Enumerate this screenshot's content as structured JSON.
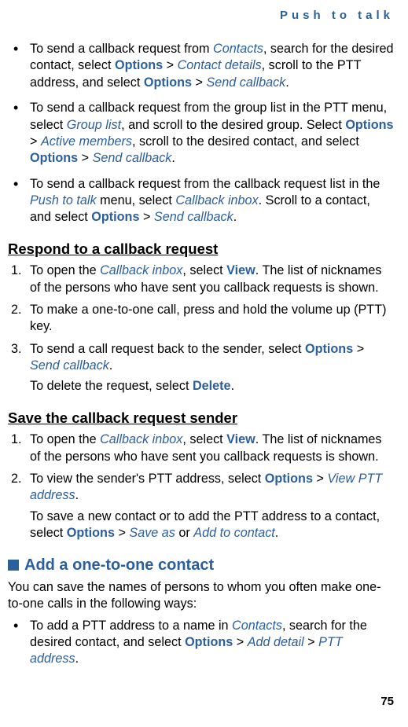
{
  "header": {
    "running": "Push to talk"
  },
  "top_bullets": [
    {
      "parts": [
        {
          "t": "To send a callback request from "
        },
        {
          "t": "Contacts",
          "cls": "kw"
        },
        {
          "t": ", search for the desired contact, select "
        },
        {
          "t": "Options",
          "cls": "kw-bold"
        },
        {
          "t": " > "
        },
        {
          "t": "Contact details",
          "cls": "kw"
        },
        {
          "t": ", scroll to the PTT address, and select "
        },
        {
          "t": "Options",
          "cls": "kw-bold"
        },
        {
          "t": " > "
        },
        {
          "t": "Send callback",
          "cls": "kw"
        },
        {
          "t": "."
        }
      ]
    },
    {
      "parts": [
        {
          "t": "To send a callback request from the group list in the PTT menu, select "
        },
        {
          "t": "Group list",
          "cls": "kw"
        },
        {
          "t": ", and scroll to the desired group. Select "
        },
        {
          "t": "Options",
          "cls": "kw-bold"
        },
        {
          "t": " > "
        },
        {
          "t": "Active members",
          "cls": "kw"
        },
        {
          "t": ", scroll to the desired contact, and select "
        },
        {
          "t": "Options",
          "cls": "kw-bold"
        },
        {
          "t": " > "
        },
        {
          "t": "Send callback",
          "cls": "kw"
        },
        {
          "t": "."
        }
      ]
    },
    {
      "parts": [
        {
          "t": "To send a callback request from the callback request list in the "
        },
        {
          "t": "Push to talk",
          "cls": "kw"
        },
        {
          "t": " menu, select "
        },
        {
          "t": "Callback inbox",
          "cls": "kw"
        },
        {
          "t": ". Scroll to a contact, and select "
        },
        {
          "t": "Options",
          "cls": "kw-bold"
        },
        {
          "t": " > "
        },
        {
          "t": "Send callback",
          "cls": "kw"
        },
        {
          "t": "."
        }
      ]
    }
  ],
  "section_respond": {
    "title": "Respond to a callback request",
    "steps": [
      {
        "main": [
          {
            "t": "To open the "
          },
          {
            "t": "Callback inbox",
            "cls": "kw"
          },
          {
            "t": ", select "
          },
          {
            "t": "View",
            "cls": "kw-bold"
          },
          {
            "t": ". The list of nicknames of the persons who have sent you callback requests is shown."
          }
        ]
      },
      {
        "main": [
          {
            "t": "To make a one-to-one call, press and hold the volume up (PTT) key."
          }
        ]
      },
      {
        "main": [
          {
            "t": "To send a call request back to the sender, select "
          },
          {
            "t": "Options",
            "cls": "kw-bold"
          },
          {
            "t": " > "
          },
          {
            "t": "Send callback",
            "cls": "kw"
          },
          {
            "t": "."
          }
        ],
        "sub": [
          {
            "t": "To delete the request, select "
          },
          {
            "t": "Delete",
            "cls": "kw-bold"
          },
          {
            "t": "."
          }
        ]
      }
    ]
  },
  "section_save": {
    "title": "Save the callback request sender",
    "steps": [
      {
        "main": [
          {
            "t": "To open the "
          },
          {
            "t": "Callback inbox",
            "cls": "kw"
          },
          {
            "t": ", select "
          },
          {
            "t": "View",
            "cls": "kw-bold"
          },
          {
            "t": ". The list of nicknames of the persons who have sent you callback requests is shown."
          }
        ]
      },
      {
        "main": [
          {
            "t": "To view the sender's PTT address, select "
          },
          {
            "t": "Options",
            "cls": "kw-bold"
          },
          {
            "t": " > "
          },
          {
            "t": "View PTT address",
            "cls": "kw"
          },
          {
            "t": "."
          }
        ],
        "sub": [
          {
            "t": "To save a new contact or to add the PTT address to a contact, select "
          },
          {
            "t": "Options",
            "cls": "kw-bold"
          },
          {
            "t": " > "
          },
          {
            "t": "Save as",
            "cls": "kw"
          },
          {
            "t": " or "
          },
          {
            "t": "Add to contact",
            "cls": "kw"
          },
          {
            "t": "."
          }
        ]
      }
    ]
  },
  "section_add": {
    "title": "Add a one-to-one contact",
    "intro": "You can save the names of persons to whom you often make one-to-one calls in the following ways:",
    "bullets": [
      {
        "parts": [
          {
            "t": "To add a PTT address to a name in "
          },
          {
            "t": "Contacts",
            "cls": "kw"
          },
          {
            "t": ", search for the desired contact, and select "
          },
          {
            "t": "Options",
            "cls": "kw-bold"
          },
          {
            "t": " > "
          },
          {
            "t": "Add detail",
            "cls": "kw"
          },
          {
            "t": " > "
          },
          {
            "t": "PTT address",
            "cls": "kw"
          },
          {
            "t": "."
          }
        ]
      }
    ]
  },
  "page_number": "75"
}
